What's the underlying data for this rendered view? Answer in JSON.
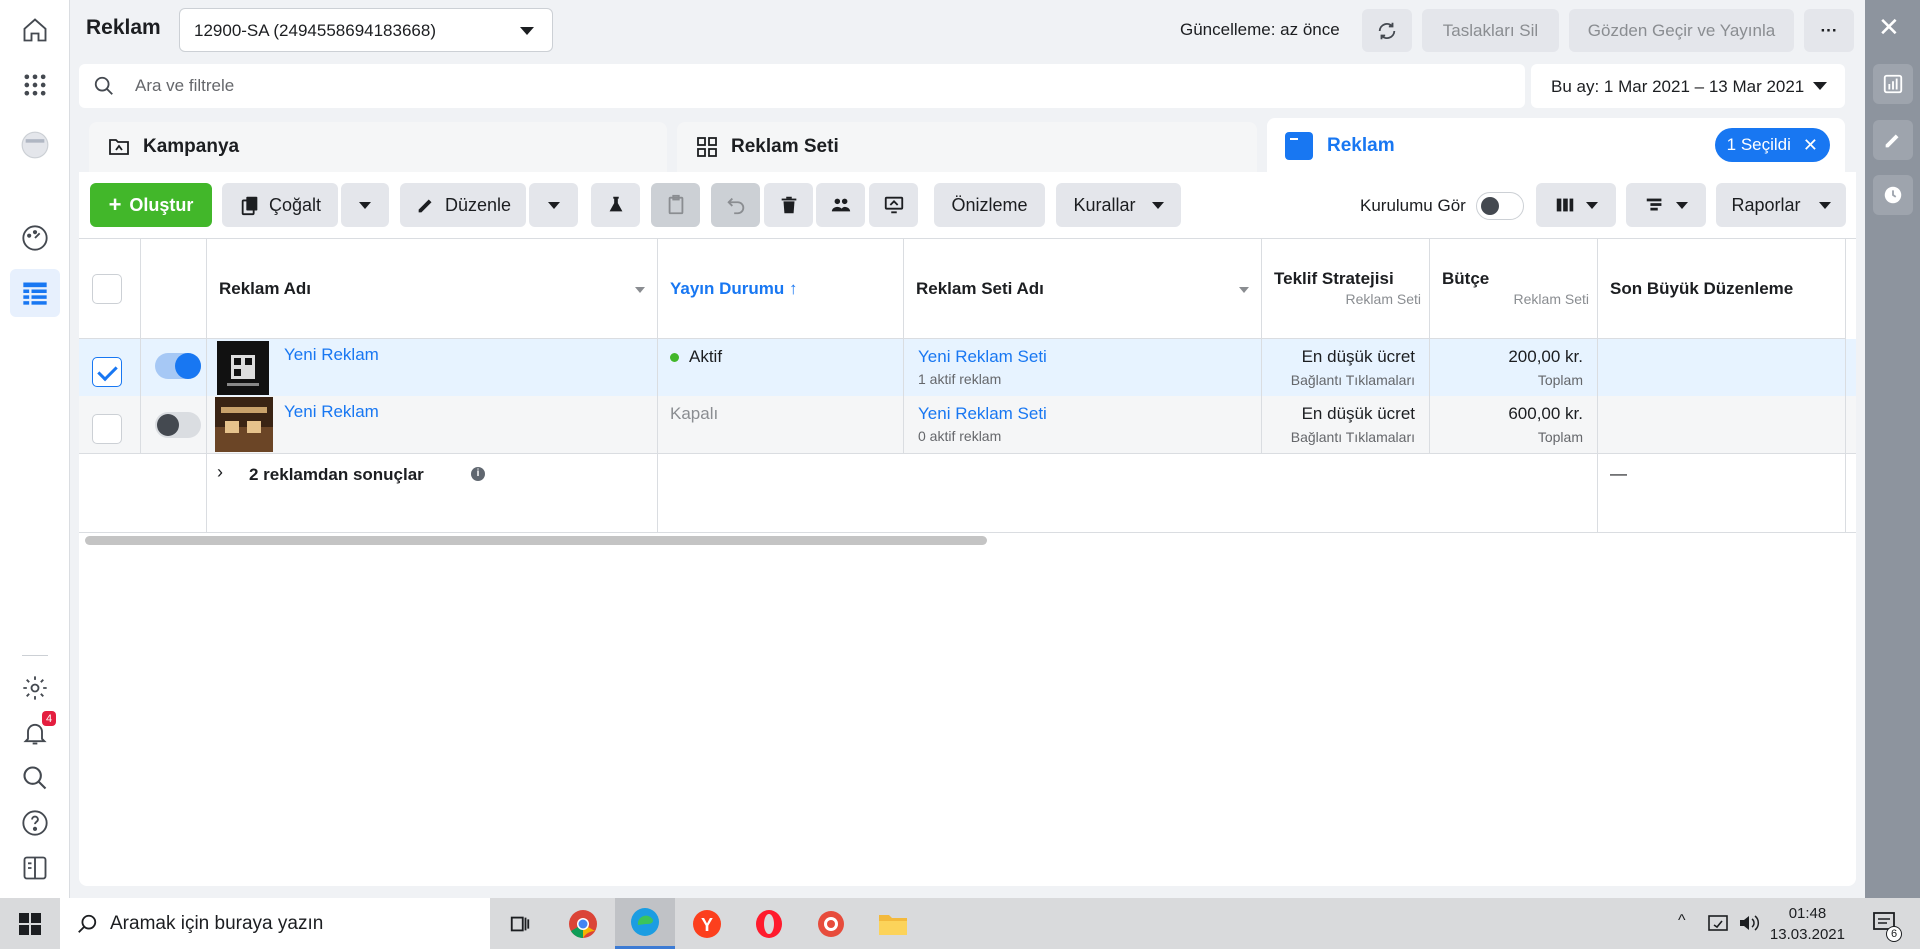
{
  "app": {
    "title": "Reklam"
  },
  "header": {
    "account": "12900-SA (2494558694183668)",
    "update_status": "Güncelleme: az önce",
    "delete_drafts": "Taslakları Sil",
    "review_publish": "Gözden Geçir ve Yayınla",
    "more": "···"
  },
  "search": {
    "placeholder": "Ara ve filtrele"
  },
  "date_range": "Bu ay: 1 Mar 2021 – 13 Mar 2021",
  "tabs": [
    {
      "label": "Kampanya"
    },
    {
      "label": "Reklam Seti"
    },
    {
      "label": "Reklam",
      "selected_badge": "1 Seçildi"
    }
  ],
  "toolbar": {
    "create": "Oluştur",
    "duplicate": "Çoğalt",
    "edit": "Düzenle",
    "preview": "Önizleme",
    "rules": "Kurallar",
    "view_setup": "Kurulumu Gör",
    "reports": "Raporlar"
  },
  "table": {
    "columns": [
      {
        "label": "Reklam Adı"
      },
      {
        "label": "Yayın Durumu ↑"
      },
      {
        "label": "Reklam Seti Adı"
      },
      {
        "label": "Teklif Stratejisi",
        "sub": "Reklam Seti"
      },
      {
        "label": "Bütçe",
        "sub": "Reklam Seti"
      },
      {
        "label": "Son Büyük Düzenleme"
      }
    ],
    "rows": [
      {
        "name": "Yeni Reklam",
        "status": "Aktif",
        "adset": "Yeni Reklam Seti",
        "adset_sub": "1 aktif reklam",
        "bid": "En düşük ücret",
        "bid_sub": "Bağlantı Tıklamaları",
        "budget": "200,00 kr.",
        "budget_sub": "Toplam",
        "checked": true,
        "on": true
      },
      {
        "name": "Yeni Reklam",
        "status": "Kapalı",
        "adset": "Yeni Reklam Seti",
        "adset_sub": "0 aktif reklam",
        "bid": "En düşük ücret",
        "bid_sub": "Bağlantı Tıklamaları",
        "budget": "600,00 kr.",
        "budget_sub": "Toplam",
        "checked": false,
        "on": false
      }
    ],
    "summary": {
      "label": "2 reklamdan sonuçlar",
      "last_edit": "—"
    }
  },
  "sidebar": {
    "notification_count": "4"
  },
  "taskbar": {
    "search_placeholder": "Aramak için buraya yazın",
    "time": "01:48",
    "date": "13.03.2021",
    "notif_count": "6"
  },
  "colors": {
    "accent": "#1877f2",
    "create": "#42b72a",
    "status_active": "#42b72a"
  }
}
